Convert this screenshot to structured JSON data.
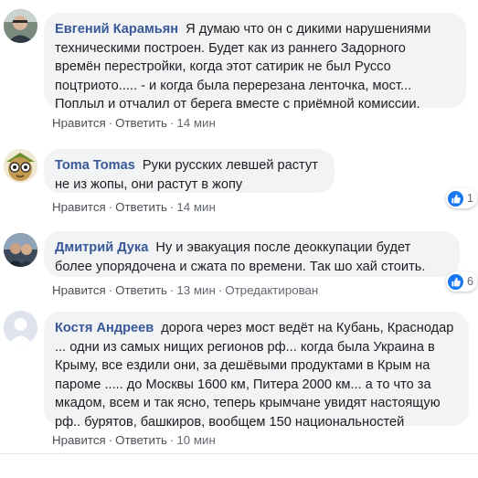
{
  "comments": [
    {
      "author": "Евгений Карамьян",
      "text": "Я думаю что он с дикими нарушениями техническими построен. Будет как из раннего Задорного времён перестройки, когда этот сатирик не был Руссо поцтриото..... - и когда была перерезана ленточка, мост... Поплыл и отчалил от берега вместе с приёмной комиссии.",
      "like": "Нравится",
      "reply": "Ответить",
      "time": "14 мин"
    },
    {
      "author": "Toma Tomas",
      "text": "Руки русских левшей растут не из жопы, они растут в жопу",
      "like": "Нравится",
      "reply": "Ответить",
      "time": "14 мин",
      "reaction_count": "1"
    },
    {
      "author": "Дмитрий Дука",
      "text": "Ну и эвакуация после деоккупации будет более упорядочена и сжата по времени. Так шо хай стоить.",
      "like": "Нравится",
      "reply": "Ответить",
      "time": "13 мин",
      "edited": "Отредактирован",
      "reaction_count": "6"
    },
    {
      "author": "Костя Андреев",
      "text": "дорога через мост ведёт на Кубань, Краснодар ... одни из самых нищих регионов рф... когда была Украина в Крыму, все ездили они, за дешёвыми продуктами в Крым на пароме ..... до Москвы 1600 км, Питера 2000 км... а то что за мкадом, всем и так ясно, теперь крымчане увидят настоящую рф.. бурятов, башкиров, вообщем 150 национальностей",
      "like": "Нравится",
      "reply": "Ответить",
      "time": "10 мин"
    }
  ],
  "icons": {
    "reaction": "thumbs-up-icon",
    "avatar_placeholder": "default-avatar-icon"
  },
  "colors": {
    "author": "#385898",
    "bubble": "#f2f3f5",
    "action_text": "#606770",
    "like_blue": "#1877f2"
  }
}
